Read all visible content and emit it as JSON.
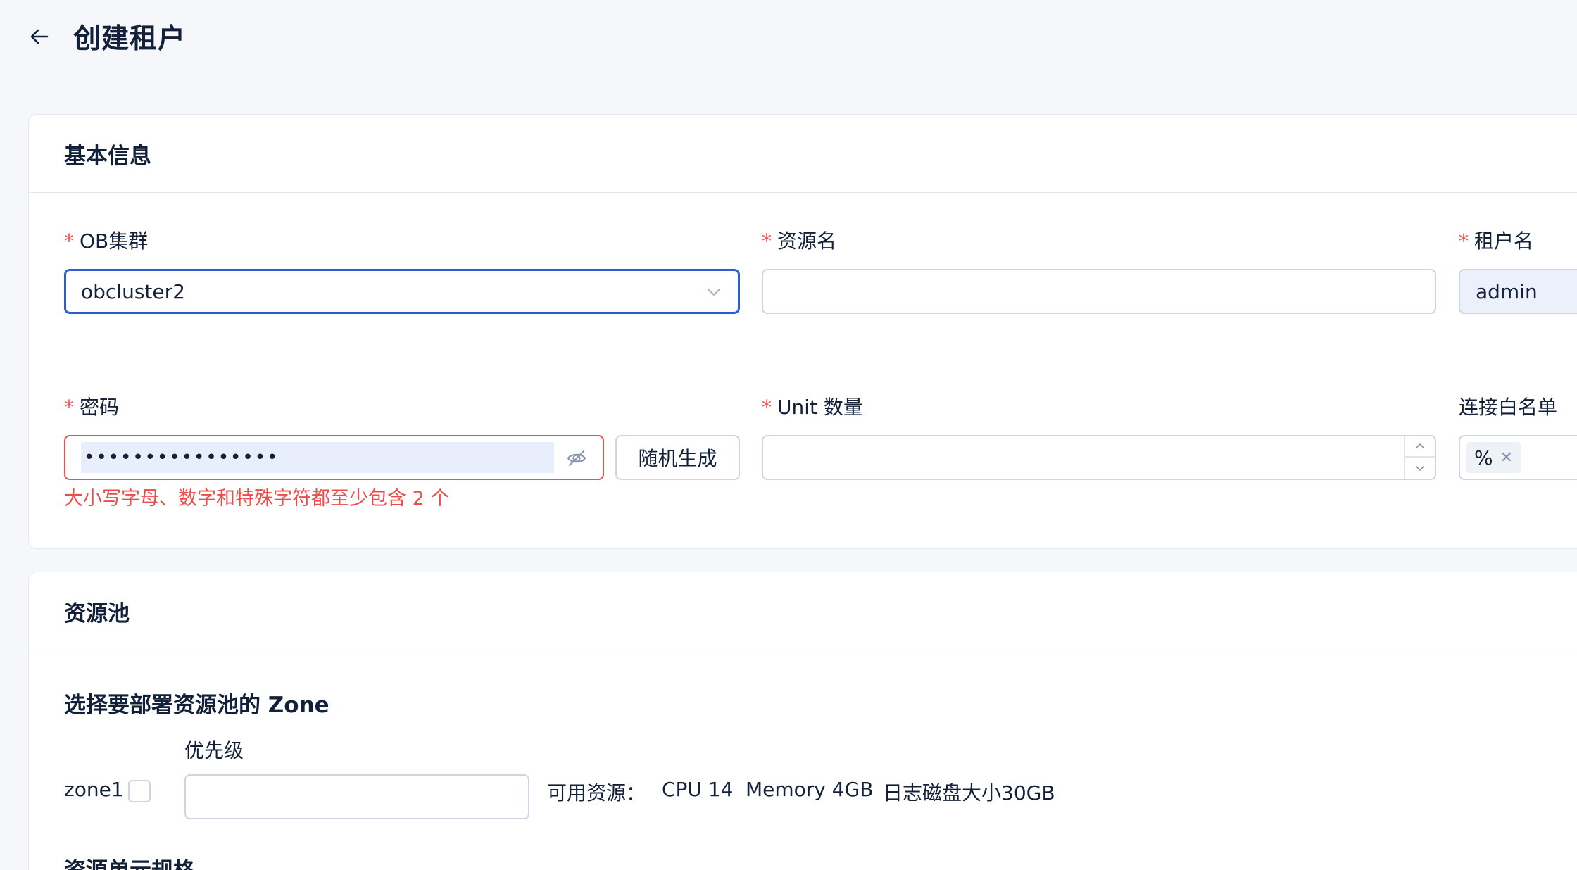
{
  "header": {
    "title": "创建租户"
  },
  "basic_info": {
    "title": "基本信息",
    "required_mark": "*",
    "ob_cluster": {
      "label": "OB集群",
      "value": "obcluster2"
    },
    "resource_name": {
      "label": "资源名",
      "value": ""
    },
    "tenant_name": {
      "label": "租户名",
      "value": "admin"
    },
    "password": {
      "label": "密码",
      "masked_value": "••••••••••••••••",
      "random_button": "随机生成",
      "error": "大小写字母、数字和特殊字符都至少包含 2 个"
    },
    "unit_count": {
      "label": "Unit 数量",
      "value": ""
    },
    "whitelist": {
      "label": "连接白名单",
      "tags": [
        "%"
      ]
    }
  },
  "resource_pool": {
    "title": "资源池",
    "zone_section_title": "选择要部署资源池的 Zone",
    "priority_label": "优先级",
    "zones": [
      {
        "name": "zone1",
        "checked": false,
        "priority": "",
        "available_label": "可用资源：",
        "cpu": "CPU 14",
        "memory": "Memory 4GB",
        "log_disk": "日志磁盘大小30GB"
      }
    ],
    "unit_spec_title": "资源单元规格"
  },
  "colors": {
    "background": "#f5f7fb",
    "card": "#ffffff",
    "primary_focus": "#2a5bd7",
    "error": "#ef4a4a",
    "required": "#f05252",
    "border": "#cdd5e4"
  },
  "icons": {
    "back": "arrow-left-icon",
    "select": "chevron-down-icon",
    "password_toggle": "eye-slash-icon",
    "step_up": "chevron-up-icon",
    "step_down": "chevron-down-icon",
    "tag_close": "close-icon"
  }
}
